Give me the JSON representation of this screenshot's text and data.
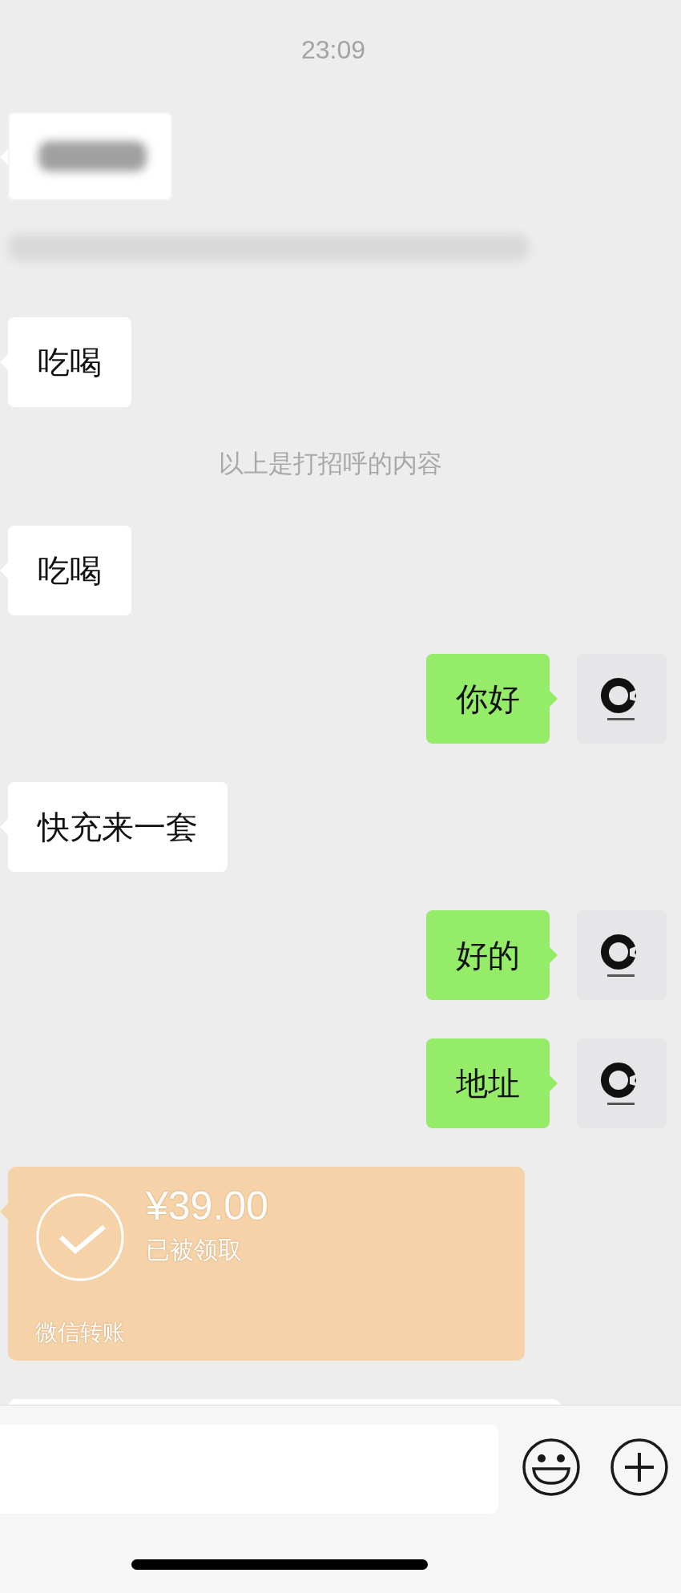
{
  "messages": [
    {
      "kind": "time",
      "text": "23:09"
    },
    {
      "kind": "redacted",
      "outgoing": false
    },
    {
      "kind": "redacted_line"
    },
    {
      "kind": "text",
      "outgoing": false,
      "text": "吃喝"
    },
    {
      "kind": "system",
      "text": "以上是打招呼的内容"
    },
    {
      "kind": "text",
      "outgoing": false,
      "text": "吃喝"
    },
    {
      "kind": "text",
      "outgoing": true,
      "text": "你好"
    },
    {
      "kind": "text",
      "outgoing": false,
      "text": "快充来一套"
    },
    {
      "kind": "text",
      "outgoing": true,
      "text": "好的"
    },
    {
      "kind": "text",
      "outgoing": true,
      "text": "地址"
    },
    {
      "kind": "transfer",
      "outgoing": false,
      "amount": "¥39.00",
      "status": "已被领取",
      "footer": "微信转账"
    },
    {
      "kind": "partial",
      "outgoing": false
    }
  ]
}
